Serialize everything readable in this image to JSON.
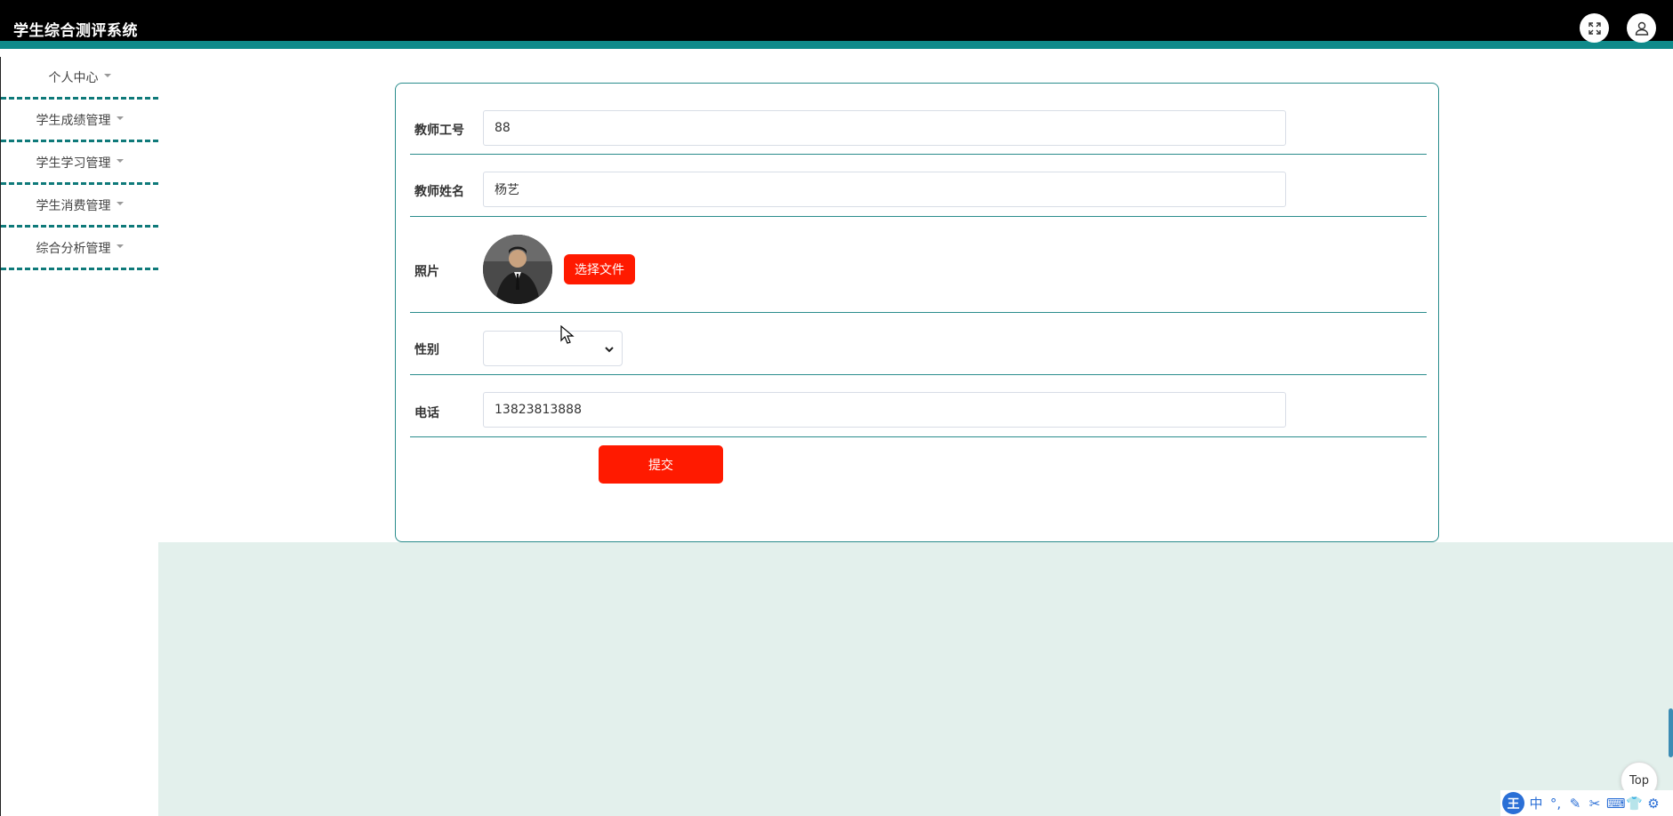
{
  "app": {
    "title": "学生综合测评系统"
  },
  "header": {
    "fullscreen_icon": "fullscreen-icon",
    "user_icon": "user-icon"
  },
  "sidebar": {
    "items": [
      {
        "label": "个人中心"
      },
      {
        "label": "学生成绩管理"
      },
      {
        "label": "学生学习管理"
      },
      {
        "label": "学生消费管理"
      },
      {
        "label": "综合分析管理"
      }
    ]
  },
  "form": {
    "teacher_id": {
      "label": "教师工号",
      "value": "88"
    },
    "teacher_name": {
      "label": "教师姓名",
      "value": "杨艺"
    },
    "photo": {
      "label": "照片",
      "button": "选择文件"
    },
    "gender": {
      "label": "性别",
      "value": ""
    },
    "phone": {
      "label": "电话",
      "value": "13823813888"
    },
    "submit": "提交"
  },
  "back_to_top": "Top",
  "ime": {
    "logo": "王",
    "items": [
      "中",
      "°,",
      "✎",
      "✂",
      "⌨",
      "👕",
      "⚙"
    ]
  },
  "colors": {
    "accent": "#0f8a8a",
    "primary_button": "#ff1a00",
    "background_lower": "#e3f0ec"
  }
}
